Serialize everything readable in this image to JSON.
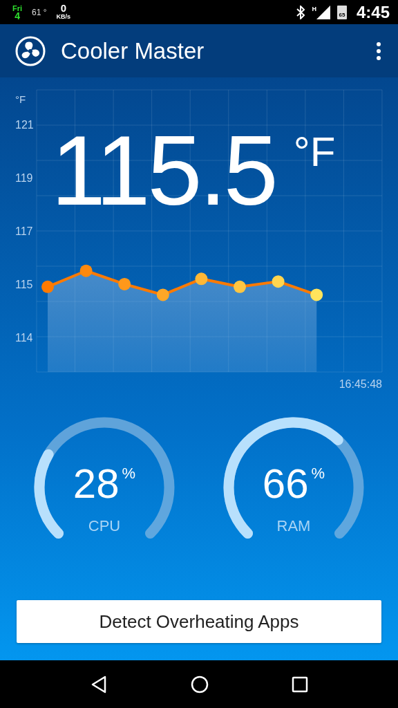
{
  "status_bar": {
    "day": "Fri",
    "date": "4",
    "temperature": "61 °",
    "speed": "0",
    "speed_unit": "KB/s",
    "signal_type": "H",
    "battery": "65",
    "time": "4:45"
  },
  "app_bar": {
    "title": "Cooler Master"
  },
  "temperature": {
    "value": "115.5",
    "unit": "°F",
    "time": "16:45:48",
    "lowest_axis_label": "114",
    "chart_data": {
      "type": "area",
      "ylabel": "°F",
      "categories": [
        null,
        null,
        null,
        null,
        null,
        null,
        null,
        null
      ],
      "ylim": [
        111.7,
        122.3
      ],
      "yticks": [
        121,
        119,
        117,
        115
      ],
      "series": [
        {
          "color": "#ff7a00",
          "values": [
            114.9,
            115.5,
            115.0,
            114.6,
            115.2,
            114.9,
            115.1,
            114.6
          ]
        }
      ]
    }
  },
  "gauges": [
    {
      "label": "CPU",
      "value": "28",
      "unit": "%"
    },
    {
      "label": "RAM",
      "value": "66",
      "unit": "%"
    }
  ],
  "button": "Detect Overheating Apps"
}
